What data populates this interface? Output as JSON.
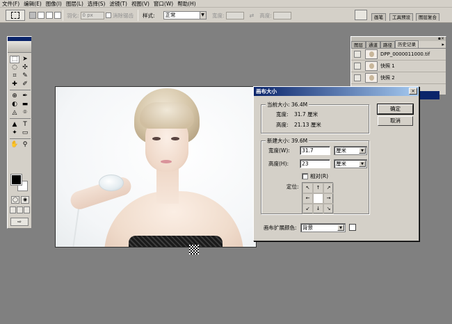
{
  "menubar": {
    "items": [
      "文件(F)",
      "编辑(E)",
      "图像(I)",
      "图层(L)",
      "选择(S)",
      "滤镜(T)",
      "视图(V)",
      "窗口(W)",
      "帮助(H)"
    ]
  },
  "options": {
    "feather_label": "羽化:",
    "feather_value": "0 px",
    "antialias_label": "消除锯齿",
    "style_label": "样式:",
    "style_value": "正常",
    "width_label": "宽度:",
    "height_label": "高度:",
    "swap_icon": "⇄",
    "well_tabs": [
      "画笔",
      "工具预设",
      "图层复合"
    ]
  },
  "history_panel": {
    "tabs": [
      "图层",
      "通道",
      "路径",
      "历史记录"
    ],
    "active_tab": "历史记录",
    "rows": [
      {
        "label": "DPP_0000011000.tif",
        "thumbnail": true
      },
      {
        "label": "快照 1",
        "thumbnail": true
      },
      {
        "label": "快照 2",
        "thumbnail": true
      }
    ]
  },
  "toolbox": {
    "tools": [
      "⬚",
      "➤",
      "◌",
      "✣",
      "⌗",
      "✎",
      "✚",
      "✐",
      "⊕",
      "✒",
      "◐",
      "▬",
      "◬",
      "⌾",
      "▲",
      "T",
      "✦",
      "▭",
      "✋",
      "⚲"
    ],
    "quickmask": [
      "◯",
      "◉"
    ]
  },
  "dialog": {
    "title": "画布大小",
    "close": "×",
    "current_size_label": "当前大小: 36.4M",
    "current_width_label": "宽度:",
    "current_width_value": "31.7 厘米",
    "current_height_label": "高度:",
    "current_height_value": "21.13 厘米",
    "new_size_label": "新建大小: 39.6M",
    "width_label": "宽度(W):",
    "width_value": "31.7",
    "width_unit": "厘米",
    "height_label": "高度(H):",
    "height_value": "23",
    "height_unit": "厘米",
    "relative_label": "相对(R)",
    "anchor_label": "定位:",
    "anchor_arrows": [
      "↖",
      "↑",
      "↗",
      "←",
      "",
      "→",
      "↙",
      "↓",
      "↘"
    ],
    "ok_label": "确定",
    "cancel_label": "取消",
    "extension_color_label": "画布扩展颜色:",
    "extension_color_value": "背景"
  }
}
